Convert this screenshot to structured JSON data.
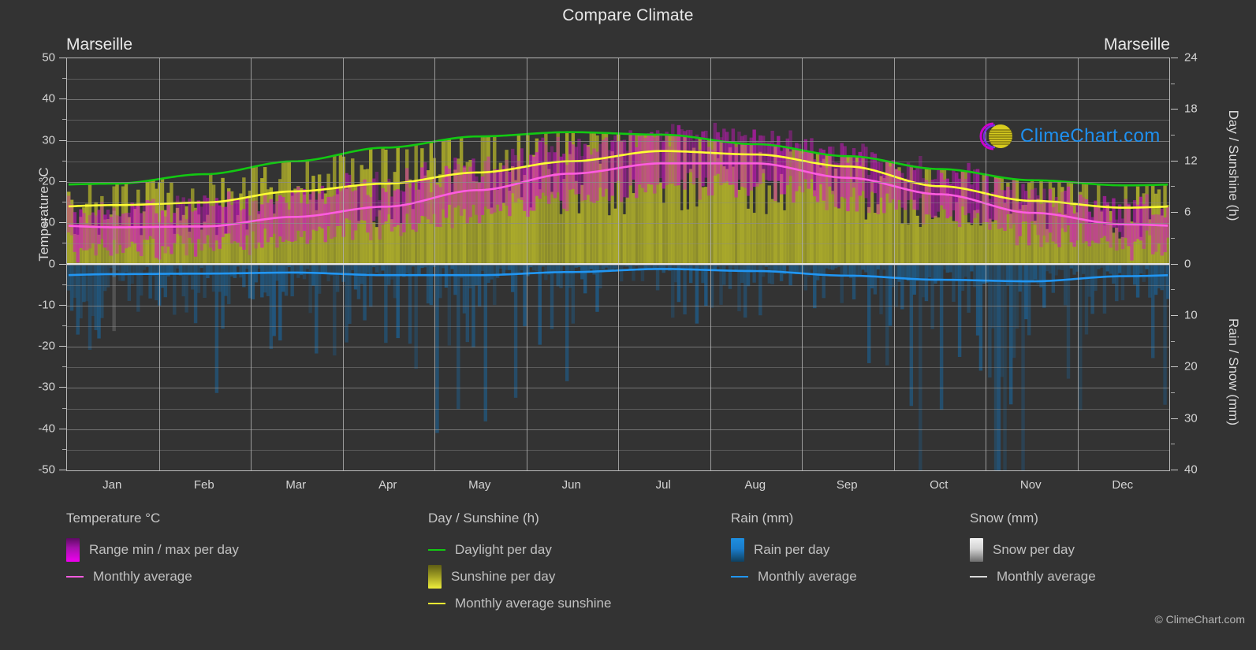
{
  "header": {
    "main_title": "Compare Climate",
    "left_location": "Marseille",
    "right_location": "Marseille"
  },
  "axes": {
    "left_label": "Temperature °C",
    "right_label_top": "Day / Sunshine (h)",
    "right_label_bottom": "Rain / Snow (mm)",
    "temp_ticks": [
      "50",
      "40",
      "30",
      "20",
      "10",
      "0",
      "-10",
      "-20",
      "-30",
      "-40",
      "-50"
    ],
    "day_ticks": [
      "24",
      "18",
      "12",
      "6",
      "0"
    ],
    "rain_ticks": [
      "0",
      "10",
      "20",
      "30",
      "40"
    ],
    "months": [
      "Jan",
      "Feb",
      "Mar",
      "Apr",
      "May",
      "Jun",
      "Jul",
      "Aug",
      "Sep",
      "Oct",
      "Nov",
      "Dec"
    ]
  },
  "legend": {
    "temperature": {
      "heading": "Temperature °C",
      "range_label": "Range min / max per day",
      "average_label": "Monthly average"
    },
    "sunshine": {
      "heading": "Day / Sunshine (h)",
      "daylight_label": "Daylight per day",
      "sunshine_label": "Sunshine per day",
      "average_label": "Monthly average sunshine"
    },
    "rain": {
      "heading": "Rain (mm)",
      "rain_label": "Rain per day",
      "average_label": "Monthly average"
    },
    "snow": {
      "heading": "Snow (mm)",
      "snow_label": "Snow per day",
      "average_label": "Monthly average"
    },
    "copyright": "© ClimeChart.com"
  },
  "watermark": {
    "text": "ClimeChart.com"
  },
  "colors": {
    "background": "#333333",
    "grid": "#8c8c8c",
    "temperature_range": "#e800e8",
    "temperature_avg": "#ff5ce0",
    "daylight": "#12c912",
    "sunshine_bar": "#b0b02a",
    "sunshine_avg": "#ffff33",
    "rain": "#1f87d6",
    "rain_avg": "#2196f3",
    "snow": "#e8e8e8",
    "brand_blue": "#1e90f0",
    "logo_magenta": "#cc00cc",
    "logo_yellow": "#d4c820",
    "text": "#d0d0d0"
  },
  "chart_data": {
    "type": "area",
    "title": "Compare Climate",
    "subtitle": "Marseille",
    "xlabel": "",
    "ylabel": "Temperature °C",
    "ylabel_right_top": "Day / Sunshine (h)",
    "ylabel_right_bottom": "Rain / Snow (mm)",
    "categories": [
      "Jan",
      "Feb",
      "Mar",
      "Apr",
      "May",
      "Jun",
      "Jul",
      "Aug",
      "Sep",
      "Oct",
      "Nov",
      "Dec"
    ],
    "ylim": [
      -50,
      50
    ],
    "ylim_right_day": [
      0,
      24
    ],
    "ylim_right_rain": [
      0,
      40
    ],
    "grid": true,
    "legend_position": "bottom",
    "series": [
      {
        "name": "Monthly average temperature",
        "unit": "°C",
        "color": "#ff5ce0",
        "values": [
          9.0,
          9.2,
          11.5,
          14.0,
          18.0,
          22.0,
          24.5,
          24.5,
          21.0,
          17.0,
          12.5,
          9.7
        ]
      },
      {
        "name": "Daily max temperature (range top)",
        "unit": "°C",
        "color": "#e800e8",
        "values": [
          13.0,
          13.5,
          16.5,
          19.0,
          23.5,
          28.0,
          31.0,
          30.5,
          26.0,
          21.5,
          16.5,
          13.5
        ]
      },
      {
        "name": "Daily min temperature (range bottom)",
        "unit": "°C",
        "color": "#e800e8",
        "values": [
          4.0,
          4.2,
          6.5,
          9.0,
          13.0,
          16.5,
          19.0,
          19.0,
          15.5,
          12.0,
          7.5,
          5.0
        ]
      },
      {
        "name": "Daylight per day",
        "unit": "h",
        "color": "#12c912",
        "values": [
          9.4,
          10.5,
          12.0,
          13.6,
          14.9,
          15.4,
          15.1,
          14.0,
          12.6,
          11.1,
          9.8,
          9.2
        ]
      },
      {
        "name": "Monthly average sunshine",
        "unit": "h",
        "color": "#ffff33",
        "values": [
          6.9,
          7.2,
          8.5,
          9.4,
          10.7,
          12.0,
          13.2,
          12.8,
          11.4,
          9.1,
          7.4,
          6.6
        ]
      },
      {
        "name": "Monthly average rain",
        "unit": "mm",
        "color": "#2196f3",
        "values": [
          1.9,
          1.8,
          1.6,
          2.1,
          2.1,
          1.5,
          0.9,
          1.3,
          2.2,
          3.0,
          3.3,
          2.3
        ]
      },
      {
        "name": "Monthly average snow",
        "unit": "mm",
        "color": "#e8e8e8",
        "values": [
          0.1,
          0.1,
          0.0,
          0.0,
          0.0,
          0.0,
          0.0,
          0.0,
          0.0,
          0.0,
          0.0,
          0.1
        ]
      }
    ]
  }
}
